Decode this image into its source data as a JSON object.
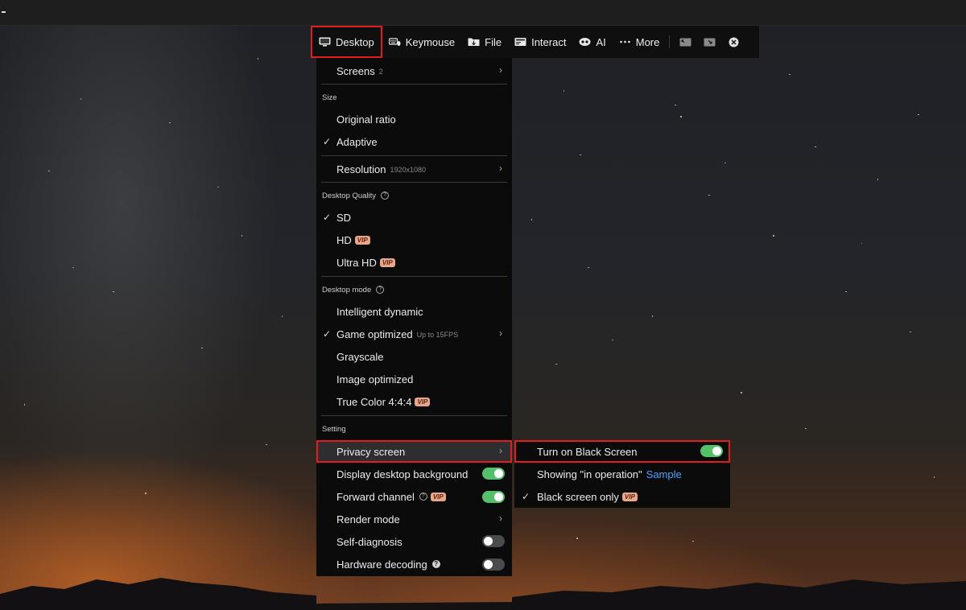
{
  "toolbar": {
    "items": [
      {
        "label": "Desktop",
        "icon": "monitor-icon",
        "active": true
      },
      {
        "label": "Keymouse",
        "icon": "keyboard-mouse-icon"
      },
      {
        "label": "File",
        "icon": "file-transfer-icon"
      },
      {
        "label": "Interact",
        "icon": "interact-icon"
      },
      {
        "label": "AI",
        "icon": "ai-eye-icon"
      },
      {
        "label": "More",
        "icon": "more-dots-icon"
      }
    ],
    "extra_icons": [
      "fit-screen-icon",
      "minimize-window-icon",
      "close-icon"
    ]
  },
  "menu": {
    "screens": {
      "label": "Screens",
      "count": "2"
    },
    "size_label": "Size",
    "original_ratio": "Original ratio",
    "adaptive": "Adaptive",
    "resolution": {
      "label": "Resolution",
      "value": "1920x1080"
    },
    "quality_label": "Desktop Quality",
    "sd": "SD",
    "hd": "HD",
    "ultra_hd": "Ultra HD",
    "mode_label": "Desktop mode",
    "intelligent_dynamic": "Intelligent dynamic",
    "game_optimized": {
      "label": "Game optimized",
      "sub": "Up to 15FPS"
    },
    "grayscale": "Grayscale",
    "image_optimized": "Image optimized",
    "true_color": "True Color 4:4:4",
    "setting_label": "Setting",
    "privacy_screen": "Privacy screen",
    "display_desktop_background": "Display desktop background",
    "forward_channel": "Forward channel",
    "render_mode": "Render mode",
    "self_diagnosis": "Self-diagnosis",
    "hardware_decoding": "Hardware decoding",
    "vip_badge": "VIP",
    "toggles": {
      "display_desktop_background": true,
      "forward_channel": true,
      "self_diagnosis": false,
      "hardware_decoding": false
    }
  },
  "submenu": {
    "turn_on_black_screen": "Turn on Black Screen",
    "turn_on_black_screen_enabled": true,
    "showing_in_operation": "Showing \"in operation\"",
    "sample_link": "Sample",
    "black_screen_only": "Black screen only"
  },
  "colors": {
    "highlight_border": "#e01e1e",
    "toggle_on": "#55c06a",
    "vip_badge_bg": "#e8a68a",
    "link": "#4aa3ff"
  }
}
